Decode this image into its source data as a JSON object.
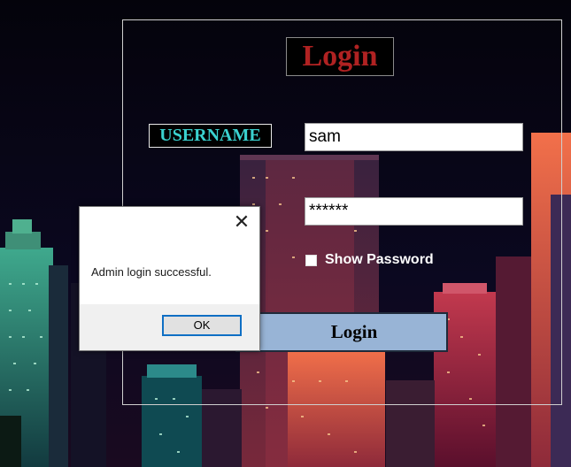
{
  "form": {
    "title": "Login",
    "username_label": "USERNAME",
    "username_value": "sam",
    "password_value": "******",
    "show_password_label": "Show Password",
    "login_button_label": "Login"
  },
  "dialog": {
    "message": "Admin login successful.",
    "ok_label": "OK",
    "close_glyph": "✕"
  },
  "colors": {
    "title_red": "#b02222",
    "label_cyan": "#3ad1cf",
    "button_blue": "#98b4d6",
    "ok_border": "#0f6fc4"
  }
}
